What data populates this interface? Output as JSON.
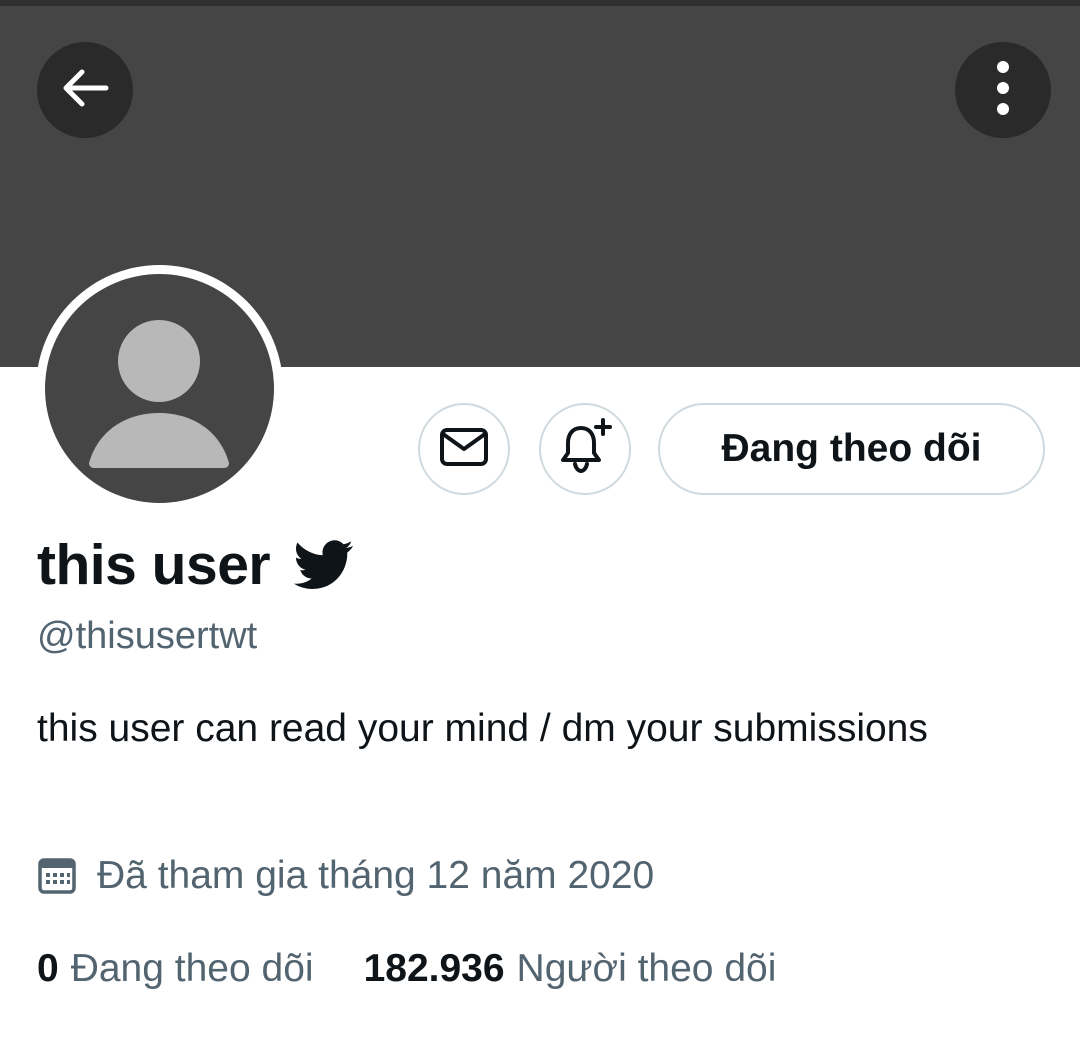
{
  "header": {
    "back_icon": "arrow-left-icon",
    "more_icon": "more-vertical-icon"
  },
  "profile": {
    "display_name": "this user",
    "verified_icon": "twitter-bird-icon",
    "handle": "@thisusertwt",
    "bio": "this user can read your mind / dm your submissions",
    "joined": "Đã tham gia tháng 12 năm 2020",
    "following_count": "0",
    "following_label": "Đang theo dõi",
    "followers_count": "182.936",
    "followers_label": "Người theo dõi"
  },
  "actions": {
    "message_icon": "envelope-icon",
    "notify_icon": "bell-plus-icon",
    "follow_label": "Đang theo dõi"
  },
  "colors": {
    "banner": "#454545",
    "text_primary": "#0f1419",
    "text_secondary": "#536471",
    "border": "#cfd9de",
    "header_button_bg": "#2a2a2a",
    "avatar_silhouette": "#b8b8b8"
  }
}
